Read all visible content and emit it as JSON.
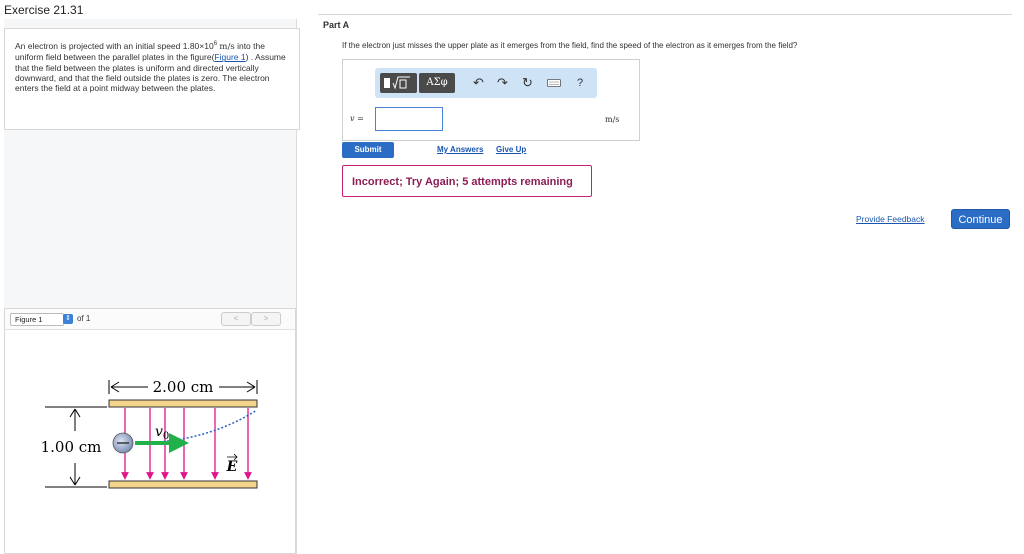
{
  "exercise": {
    "title": "Exercise 21.31"
  },
  "problem": {
    "text_1": "An electron is projected with an initial speed 1.80×10",
    "exp": "6",
    "unit": "m/s",
    "text_2": " into the uniform field between the parallel plates in the figure(",
    "figure_link": "Figure 1",
    "text_3": ") . Assume that the field between the plates is uniform and directed vertically downward, and that the field outside the plates is zero. The electron enters the field at a point midway between the plates."
  },
  "figure": {
    "selector": "Figure 1",
    "of_label": "of 1",
    "prev": "<",
    "next": ">",
    "width_label": "2.00 cm",
    "height_label": "1.00 cm",
    "velocity_label": "v",
    "velocity_sub": "0",
    "field_label": "E"
  },
  "part": {
    "title": "Part A",
    "question": "If the electron just misses the upper plate as it emerges from the field, find the speed of the electron as it emerges from the field?"
  },
  "answer": {
    "variable": "v =",
    "value": "",
    "unit": "m/s",
    "symbols_btn": "ΑΣφ",
    "help_btn": "?"
  },
  "actions": {
    "submit": "Submit",
    "my_answers": "My Answers",
    "give_up": "Give Up"
  },
  "feedback": {
    "message": "Incorrect; Try Again; 5 attempts remaining"
  },
  "footer": {
    "provide_feedback": "Provide Feedback",
    "continue": "Continue"
  },
  "colors": {
    "accent": "#2b6cc4",
    "error_border": "#c2227a",
    "field_lines": "#e0158a",
    "plates": "#f2d58a",
    "velocity_arrow": "#22b04b"
  }
}
